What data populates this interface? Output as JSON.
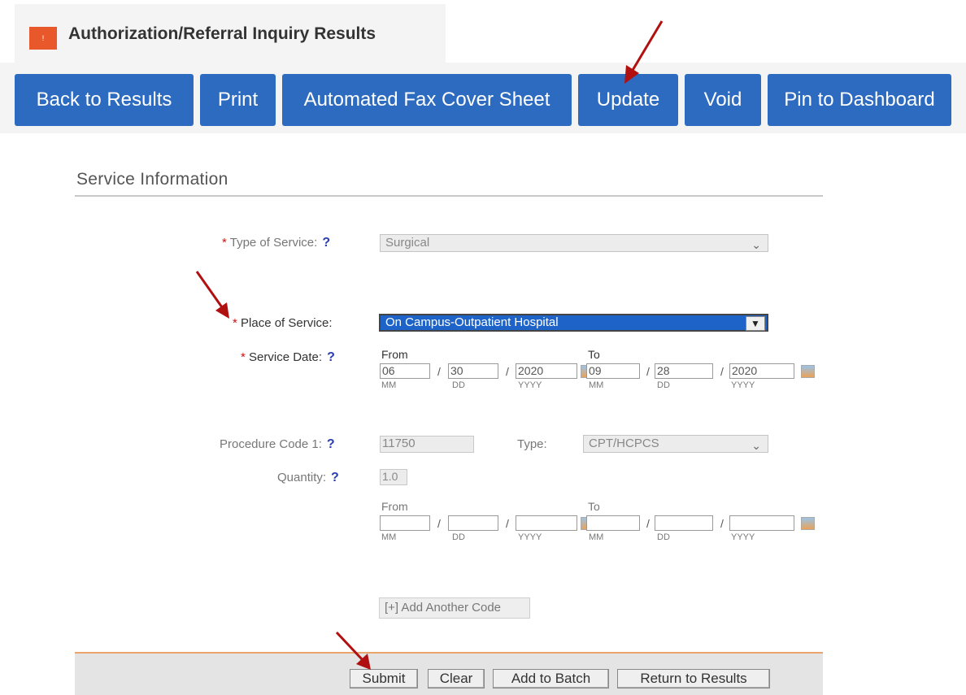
{
  "header": {
    "icon": "alert-icon",
    "icon_glyph": "!",
    "title": "Authorization/Referral Inquiry Results"
  },
  "toolbar": {
    "back": "Back to Results",
    "print": "Print",
    "fax": "Automated Fax Cover Sheet",
    "update": "Update",
    "void": "Void",
    "pin": "Pin to Dashboard"
  },
  "section": {
    "title": "Service Information"
  },
  "form": {
    "type_of_service": {
      "label": "Type of Service:",
      "value": "Surgical"
    },
    "place_of_service": {
      "label": "Place of Service:",
      "value": "On Campus-Outpatient Hospital"
    },
    "service_date": {
      "label": "Service Date:",
      "from_label": "From",
      "to_label": "To",
      "from": {
        "mm": "06",
        "dd": "30",
        "yyyy": "2020"
      },
      "to": {
        "mm": "09",
        "dd": "28",
        "yyyy": "2020"
      }
    },
    "procedure_code": {
      "label": "Procedure Code 1:",
      "value": "11750",
      "type_label": "Type:",
      "type_value": "CPT/HCPCS"
    },
    "quantity": {
      "label": "Quantity:",
      "value": "1.0"
    },
    "code_dates": {
      "from_label": "From",
      "to_label": "To"
    },
    "sub_labels": {
      "mm": "MM",
      "dd": "DD",
      "yyyy": "YYYY"
    },
    "required_mark": "*",
    "help_mark": "?",
    "slash": "/",
    "add_code": "[+] Add Another Code"
  },
  "footer": {
    "submit": "Submit",
    "clear": "Clear",
    "add_batch": "Add to Batch",
    "return": "Return to Results"
  },
  "colors": {
    "toolbar_button": "#2c6bbf",
    "header_icon": "#e8582a",
    "annotation_arrow": "#b01010",
    "footer_rule": "#e9a56a"
  }
}
